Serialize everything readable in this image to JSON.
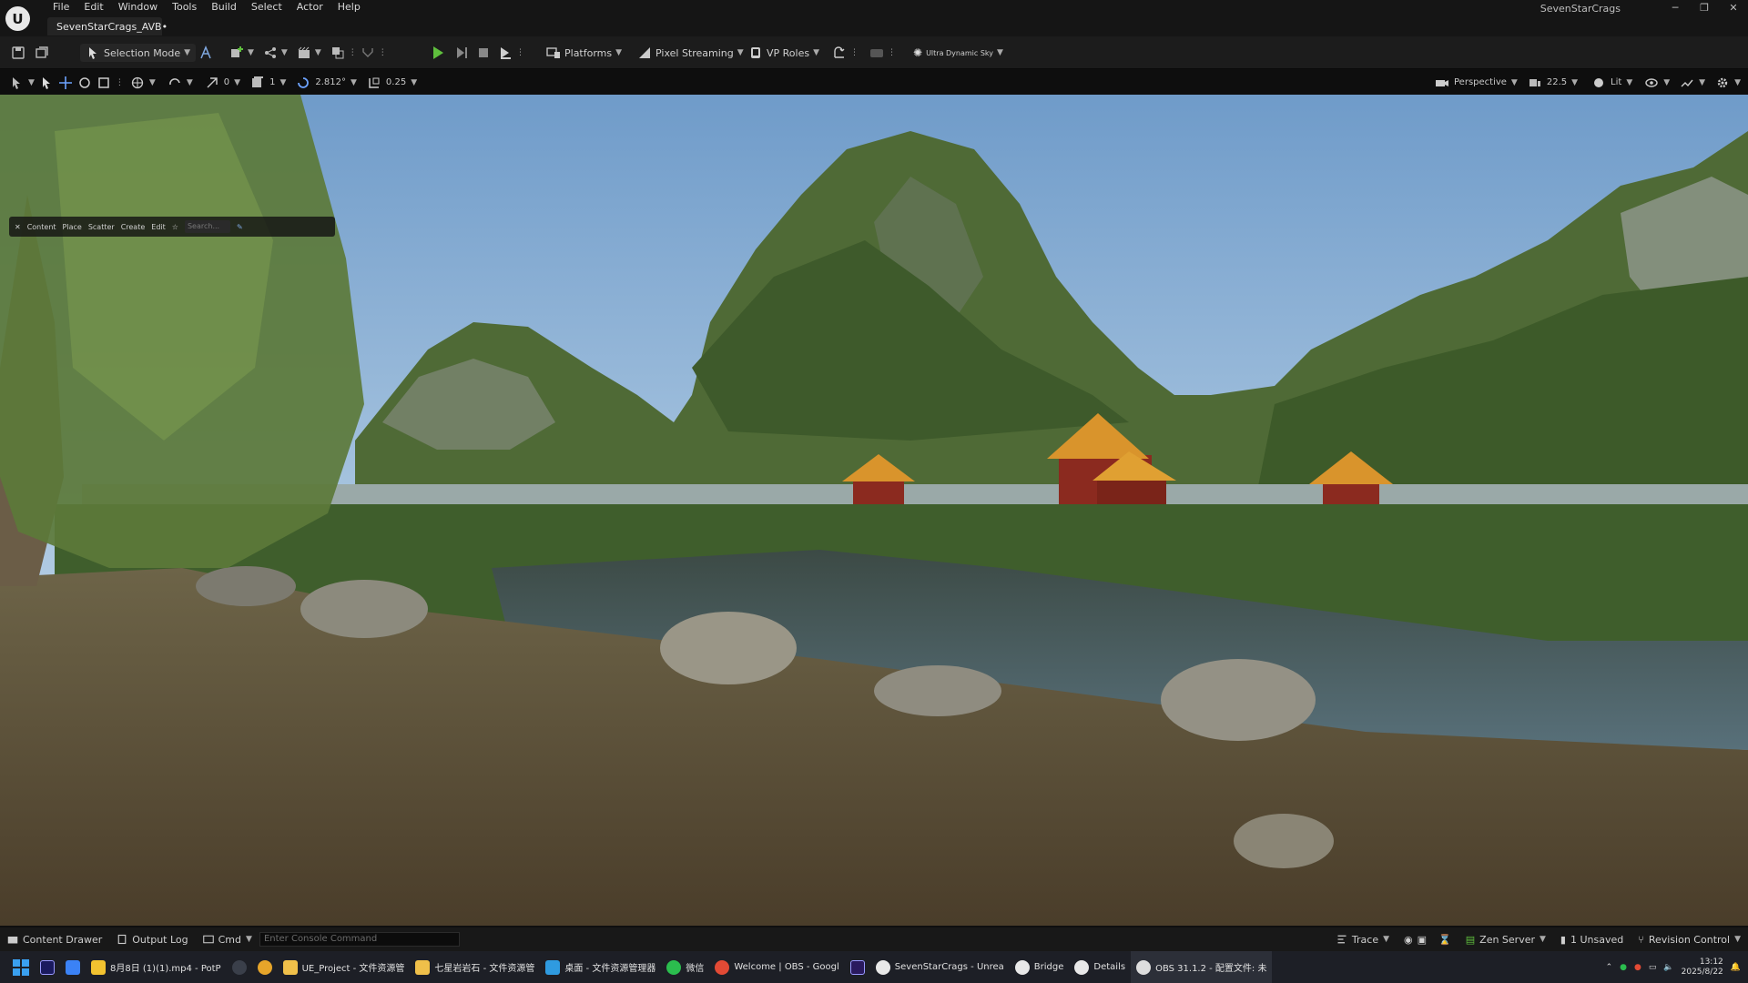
{
  "window": {
    "title": "SevenStarCrags",
    "logo": "ue-logo",
    "level_tab": "SevenStarCrags_AVB•",
    "menu": [
      "File",
      "Edit",
      "Window",
      "Tools",
      "Build",
      "Select",
      "Actor",
      "Help"
    ],
    "controls": [
      "minimize-icon",
      "restore-icon",
      "close-icon"
    ]
  },
  "toolbar": {
    "selection_mode": "Selection Mode",
    "platforms": "Platforms",
    "pixel_streaming": "Pixel Streaming",
    "vp_roles": "VP Roles",
    "ultra_dynamic_sky": "Ultra Dynamic Sky"
  },
  "viewport_toolbar": {
    "rotate_snap": "0",
    "scale_value": "1",
    "angle_snap": "2.812°",
    "grid_snap": "0.25",
    "perspective": "Perspective",
    "camera_speed": "22.5",
    "view_mode": "Lit"
  },
  "foliage_bar": {
    "items": [
      "Content",
      "Place",
      "Scatter",
      "Create",
      "Edit"
    ],
    "search_placeholder": "Search..."
  },
  "statusbar": {
    "content_drawer": "Content Drawer",
    "output_log": "Output Log",
    "cmd": "Cmd",
    "console_placeholder": "Enter Console Command",
    "trace": "Trace",
    "zen_server": "Zen Server",
    "unsaved": "1 Unsaved",
    "revision_control": "Revision Control"
  },
  "taskbar": {
    "items": [
      {
        "label": "8月8日 (1)(1).mp4 - PotP",
        "color": "#f2c230"
      },
      {
        "label": "UE_Project - 文件资源管",
        "color": "#f0c04a"
      },
      {
        "label": "七星岩岩石 - 文件资源管",
        "color": "#f0c04a"
      },
      {
        "label": "桌面 - 文件资源管理器",
        "color": "#2f9be0"
      },
      {
        "label": "微信",
        "color": "#2bbd4e"
      },
      {
        "label": "Welcome | OBS - Googl",
        "color": "#e24a35"
      },
      {
        "label": "SevenStarCrags - Unrea",
        "color": "#e8e8e8"
      },
      {
        "label": "Bridge",
        "color": "#e8e8e8"
      },
      {
        "label": "Details",
        "color": "#e8e8e8"
      },
      {
        "label": "OBS 31.1.2 - 配置文件: 未",
        "color": "#dddddd"
      }
    ],
    "clock_time": "13:12",
    "clock_date": "2025/8/22"
  }
}
